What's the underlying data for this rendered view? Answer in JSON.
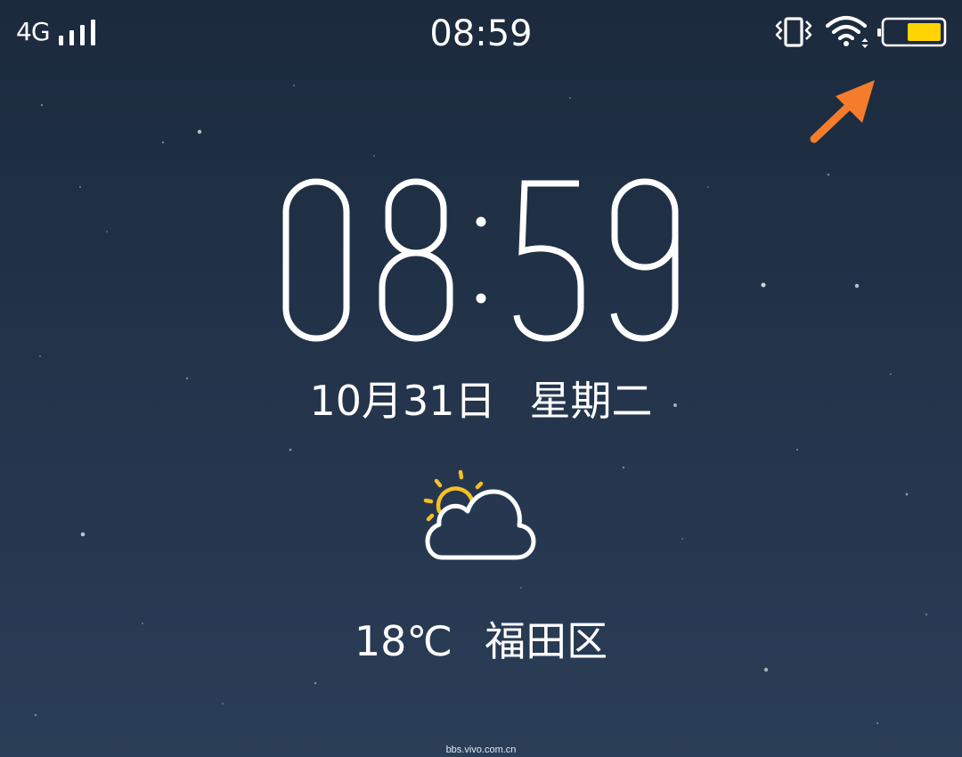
{
  "status_bar": {
    "network": "4G",
    "time": "08:59",
    "battery_color": "#ffd400"
  },
  "lockscreen": {
    "clock": {
      "hours": "08",
      "minutes": "59"
    },
    "date": "10月31日",
    "weekday": "星期二",
    "weather": {
      "icon": "partly-cloudy-icon",
      "temperature": "18℃",
      "location": "福田区",
      "sun_color": "#f5c026"
    }
  },
  "annotation": {
    "arrow_color": "#f47c2c"
  },
  "watermark": "bbs.vivo.com.cn"
}
